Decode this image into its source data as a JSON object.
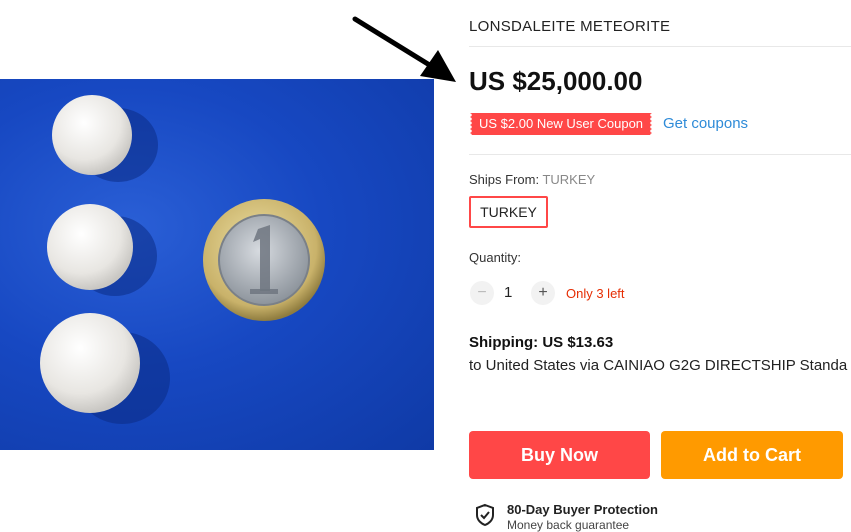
{
  "product": {
    "title": "LONSDALEITE METEORITE",
    "price": "US $25,000.00",
    "coupon_label": "US $2.00 New User Coupon",
    "get_coupons": "Get coupons"
  },
  "shipping_from": {
    "label": "Ships From:",
    "value": "TURKEY",
    "option": "TURKEY"
  },
  "quantity": {
    "label": "Quantity:",
    "minus": "−",
    "value": "1",
    "plus": "+",
    "stock": "Only 3 left"
  },
  "shipping": {
    "label": "Shipping:",
    "cost": "US $13.63",
    "route": "to United States via CAINIAO G2G DIRECTSHIP Standa"
  },
  "actions": {
    "buy_now": "Buy Now",
    "add_to_cart": "Add to Cart"
  },
  "protection": {
    "title": "80-Day Buyer Protection",
    "subtitle": "Money back guarantee"
  },
  "colors": {
    "accent_red": "#ff4747",
    "accent_orange": "#ff9a00",
    "link_blue": "#2e8bd8",
    "stock_red": "#e62e04"
  }
}
